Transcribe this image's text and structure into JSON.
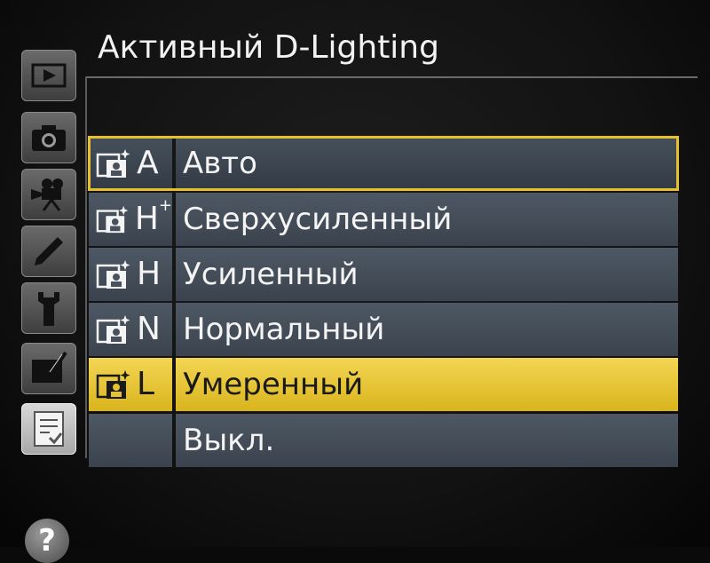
{
  "title": "Активный D-Lighting",
  "sidebar": {
    "tabs": [
      {
        "icon": "playback-icon"
      },
      {
        "icon": "camera-icon"
      },
      {
        "icon": "movie-camera-icon"
      },
      {
        "icon": "pencil-icon"
      },
      {
        "icon": "wrench-icon"
      },
      {
        "icon": "retouch-icon"
      },
      {
        "icon": "my-menu-icon",
        "active": true
      }
    ],
    "help": "?"
  },
  "menu": {
    "items": [
      {
        "code": "A",
        "sup": "",
        "label": "Авто",
        "state": "cursor"
      },
      {
        "code": "H",
        "sup": "+",
        "label": "Сверхусиленный",
        "state": ""
      },
      {
        "code": "H",
        "sup": "",
        "label": "Усиленный",
        "state": ""
      },
      {
        "code": "N",
        "sup": "",
        "label": "Нормальный",
        "state": ""
      },
      {
        "code": "L",
        "sup": "",
        "label": "Умеренный",
        "state": "selected"
      },
      {
        "code": "",
        "sup": "",
        "label": "Выкл.",
        "state": ""
      }
    ]
  },
  "colors": {
    "highlight": "#e6c12a",
    "row": "#444e59"
  }
}
